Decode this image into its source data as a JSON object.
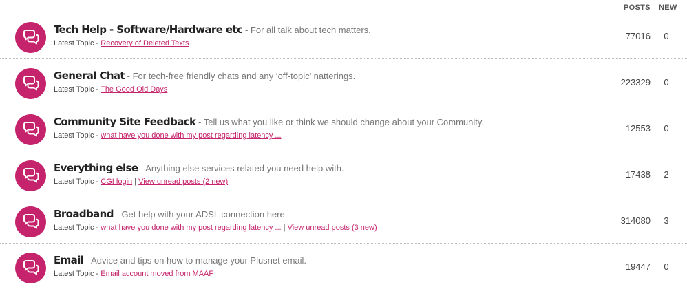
{
  "header": {
    "posts_label": "POSTS",
    "new_label": "NEW"
  },
  "boards": [
    {
      "name": "Tech Help - Software/Hardware etc",
      "desc_sep": " - ",
      "description": "For all talk about tech matters.",
      "latest_label": "Latest Topic - ",
      "latest_topic": "Recovery of Deleted Texts",
      "unread": "",
      "posts": "77016",
      "new": "0"
    },
    {
      "name": "General Chat",
      "desc_sep": " - ",
      "description": "For tech-free friendly chats and any ‘off-topic’ natterings.",
      "latest_label": "Latest Topic - ",
      "latest_topic": "The Good Old Days",
      "unread": "",
      "posts": "223329",
      "new": "0"
    },
    {
      "name": "Community Site Feedback",
      "desc_sep": " - ",
      "description": "Tell us what you like or think we should change about your Community.",
      "latest_label": "Latest Topic - ",
      "latest_topic": "what have you done with my post regarding latency ...",
      "unread": "",
      "posts": "12553",
      "new": "0"
    },
    {
      "name": "Everything else",
      "desc_sep": " - ",
      "description": "Anything else services related you need help with.",
      "latest_label": "Latest Topic - ",
      "latest_topic": "CGI login",
      "unread": "View unread posts (2 new)",
      "posts": "17438",
      "new": "2"
    },
    {
      "name": "Broadband",
      "desc_sep": " - ",
      "description": "Get help with your ADSL connection here.",
      "latest_label": "Latest Topic - ",
      "latest_topic": "what have you done with my post regarding latency ...",
      "unread": "View unread posts (3 new)",
      "posts": "314080",
      "new": "3"
    },
    {
      "name": "Email",
      "desc_sep": " - ",
      "description": "Advice and tips on how to manage your Plusnet email.",
      "latest_label": "Latest Topic - ",
      "latest_topic": "Email account moved from MAAF",
      "unread": "",
      "posts": "19447",
      "new": "0"
    }
  ],
  "colors": {
    "accent": "#c5236b",
    "text": "#333333",
    "muted": "#777777"
  },
  "icon": "speech-bubbles-icon"
}
